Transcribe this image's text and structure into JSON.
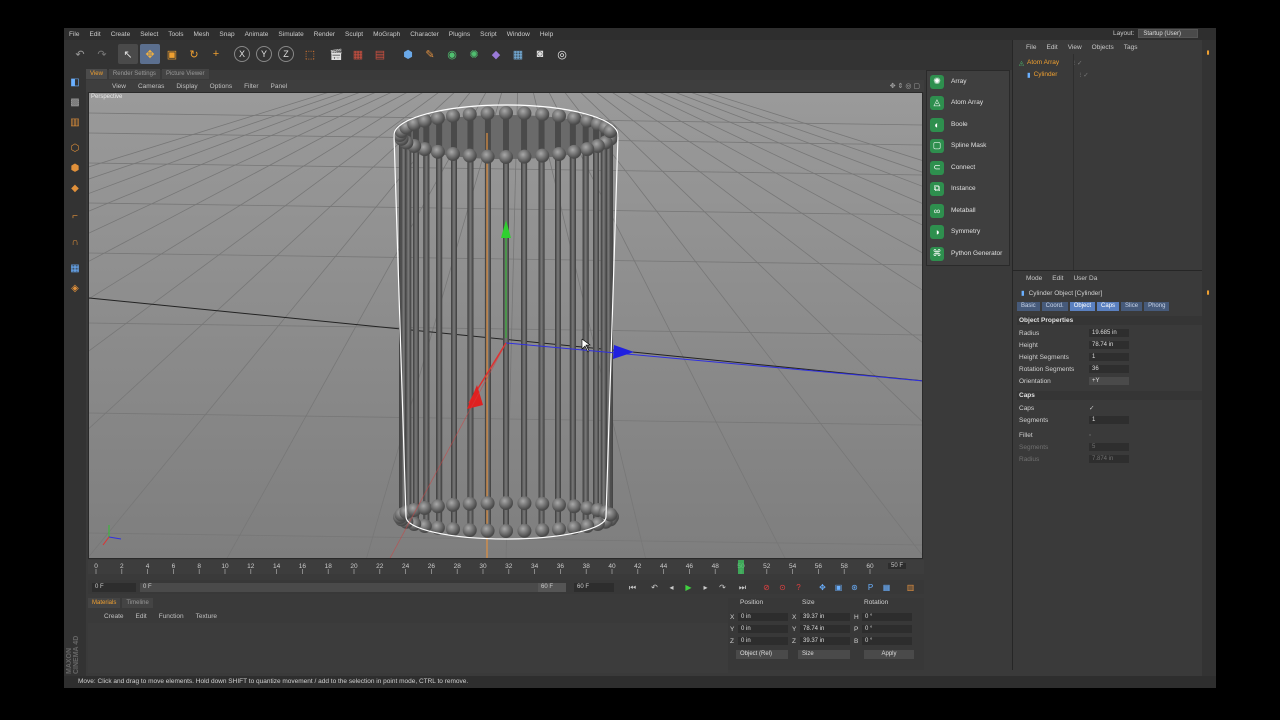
{
  "menubar": {
    "items": [
      "File",
      "Edit",
      "Create",
      "Select",
      "Tools",
      "Mesh",
      "Snap",
      "Animate",
      "Simulate",
      "Render",
      "Sculpt",
      "MoGraph",
      "Character",
      "Plugins",
      "Script",
      "Window",
      "Help"
    ],
    "layout_label": "Layout:",
    "layout_value": "Startup (User)"
  },
  "viewport": {
    "tabs": [
      "View",
      "Render Settings",
      "Picture Viewer"
    ],
    "menu": [
      "View",
      "Cameras",
      "Display",
      "Options",
      "Filter",
      "Panel"
    ],
    "label": "Perspective"
  },
  "generators": {
    "items": [
      {
        "label": "Array",
        "icon": "array-icon"
      },
      {
        "label": "Atom Array",
        "icon": "atom-array-icon"
      },
      {
        "label": "Boole",
        "icon": "boole-icon"
      },
      {
        "label": "Spline Mask",
        "icon": "spline-mask-icon"
      },
      {
        "label": "Connect",
        "icon": "connect-icon"
      },
      {
        "label": "Instance",
        "icon": "instance-icon"
      },
      {
        "label": "Metaball",
        "icon": "metaball-icon"
      },
      {
        "label": "Symmetry",
        "icon": "symmetry-icon"
      },
      {
        "label": "Python Generator",
        "icon": "python-generator-icon"
      }
    ]
  },
  "objects": {
    "menu": [
      "File",
      "Edit",
      "View",
      "Objects",
      "Tags"
    ],
    "tree": [
      {
        "name": "Atom Array",
        "color": "#f0a030"
      },
      {
        "name": "Cylinder",
        "color": "#f0a030"
      }
    ]
  },
  "attributes": {
    "menu": [
      "Mode",
      "Edit",
      "User Da"
    ],
    "title": "Cylinder Object [Cylinder]",
    "tabs": [
      "Basic",
      "Coord.",
      "Object",
      "Caps",
      "Slice",
      "Phong"
    ],
    "section_object": "Object Properties",
    "radius_label": "Radius",
    "radius": "19.685 in",
    "height_label": "Height",
    "height": "78.74 in",
    "height_segments_label": "Height Segments",
    "height_segments": "1",
    "rotation_segments_label": "Rotation Segments",
    "rotation_segments": "36",
    "orientation_label": "Orientation",
    "orientation": "+Y",
    "section_caps": "Caps",
    "caps_label": "Caps",
    "caps_check": "✓",
    "segments_label": "Segments",
    "segments": "1",
    "fillet_label": "Fillet",
    "fillet_segments_label": "Segments",
    "fillet_segments": "5",
    "fillet_radius_label": "Radius",
    "fillet_radius": "7.874 in"
  },
  "timeline": {
    "ticks": [
      "0",
      "2",
      "4",
      "6",
      "8",
      "10",
      "12",
      "14",
      "16",
      "18",
      "20",
      "22",
      "24",
      "26",
      "28",
      "30",
      "32",
      "34",
      "36",
      "38",
      "40",
      "42",
      "44",
      "46",
      "48",
      "50",
      "52",
      "54",
      "56",
      "58",
      "60"
    ],
    "current": "50",
    "end_frame": "50 F",
    "start_field": "0 F",
    "min_field": "0 F",
    "max_field": "60 F",
    "mid_field": "60 F"
  },
  "materials": {
    "tabs": [
      "Materials",
      "Timeline"
    ],
    "menu": [
      "Create",
      "Edit",
      "Function",
      "Texture"
    ]
  },
  "coordinates": {
    "headers": [
      "Position",
      "Size",
      "Rotation"
    ],
    "pos": [
      {
        "axis": "X",
        "value": "0 in"
      },
      {
        "axis": "Y",
        "value": "0 in"
      },
      {
        "axis": "Z",
        "value": "0 in"
      }
    ],
    "size": [
      {
        "axis": "X",
        "value": "39.37 in"
      },
      {
        "axis": "Y",
        "value": "78.74 in"
      },
      {
        "axis": "Z",
        "value": "39.37 in"
      }
    ],
    "rot": [
      {
        "axis": "H",
        "value": "0 °"
      },
      {
        "axis": "P",
        "value": "0 °"
      },
      {
        "axis": "B",
        "value": "0 °"
      }
    ],
    "mode": "Object (Rel)",
    "size_mode": "Size",
    "apply": "Apply"
  },
  "status": "Move: Click and drag to move elements. Hold down SHIFT to quantize movement / add to the selection in point mode, CTRL to remove.",
  "brand": "MAXON CINEMA 4D",
  "colors": {
    "accent": "#f0a030",
    "generator_green": "#2e8f4e",
    "selected_tab": "#5a80c0"
  }
}
